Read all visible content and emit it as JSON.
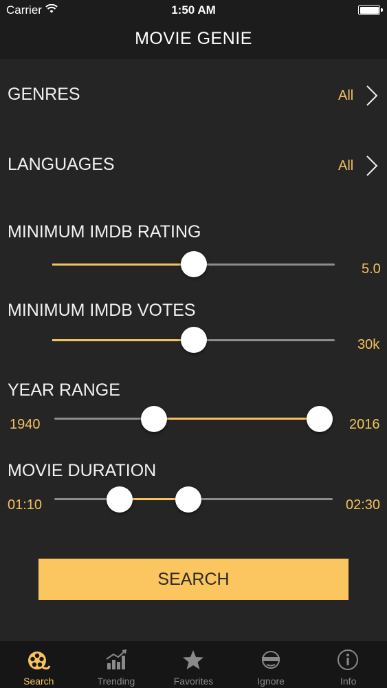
{
  "status": {
    "carrier": "Carrier",
    "time": "1:50 AM"
  },
  "header": {
    "title": "MOVIE GENIE"
  },
  "filters": {
    "genres": {
      "label": "GENRES",
      "value": "All"
    },
    "languages": {
      "label": "LANGUAGES",
      "value": "All"
    }
  },
  "sliders": {
    "rating": {
      "label": "MINIMUM IMDB RATING",
      "value": "5.0"
    },
    "votes": {
      "label": "MINIMUM IMDB VOTES",
      "value": "30k"
    },
    "year": {
      "label": "YEAR RANGE",
      "min_label": "1940",
      "max_label": "2016"
    },
    "duration": {
      "label": "MOVIE DURATION",
      "min_label": "01:10",
      "max_label": "02:30"
    }
  },
  "search_button": {
    "label": "SEARCH"
  },
  "tabs": [
    {
      "label": "Search",
      "icon": "film-reel-icon",
      "active": true
    },
    {
      "label": "Trending",
      "icon": "chart-icon",
      "active": false
    },
    {
      "label": "Favorites",
      "icon": "star-icon",
      "active": false
    },
    {
      "label": "Ignore",
      "icon": "blindfold-icon",
      "active": false
    },
    {
      "label": "Info",
      "icon": "info-icon",
      "active": false
    }
  ],
  "colors": {
    "accent": "#f8c35e",
    "background": "#252525",
    "bar": "#1c1c1c"
  }
}
